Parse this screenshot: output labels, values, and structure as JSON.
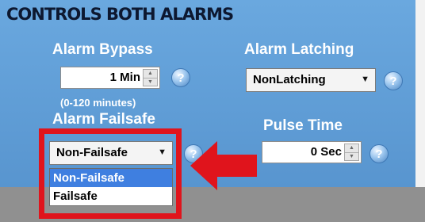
{
  "section": {
    "title": "CONTROLS BOTH ALARMS"
  },
  "alarm_bypass": {
    "label": "Alarm Bypass",
    "value": "1 Min",
    "range_note": "(0-120 minutes)"
  },
  "alarm_latching": {
    "label": "Alarm Latching",
    "selected": "NonLatching"
  },
  "alarm_failsafe": {
    "label": "Alarm Failsafe",
    "selected": "Non-Failsafe",
    "options": [
      "Non-Failsafe",
      "Failsafe"
    ],
    "highlighted_option": "Non-Failsafe"
  },
  "pulse_time": {
    "label": "Pulse Time",
    "value": "0 Sec"
  },
  "help": {
    "glyph": "?"
  },
  "colors": {
    "panel": "#5e9fd8",
    "highlight_border": "#e0141c",
    "arrow": "#e0141c",
    "selected_option": "#3f7fe0"
  }
}
